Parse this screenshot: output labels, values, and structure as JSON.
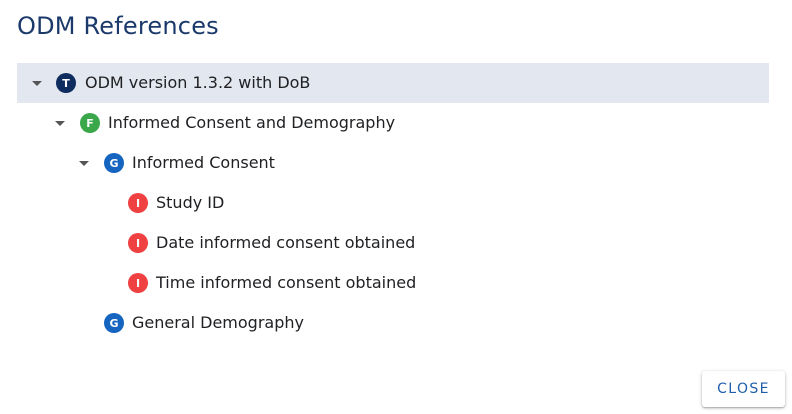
{
  "dialog": {
    "title": "ODM References",
    "close_label": "CLOSE"
  },
  "tree": [
    {
      "type_letter": "T",
      "type_color": "#0f2c5e",
      "label": "ODM version 1.3.2 with DoB",
      "expanded": true,
      "selected": true,
      "depth": 0
    },
    {
      "type_letter": "F",
      "type_color": "#3aa84a",
      "label": "Informed Consent and Demography",
      "expanded": true,
      "selected": false,
      "depth": 1
    },
    {
      "type_letter": "G",
      "type_color": "#1565c0",
      "label": "Informed Consent",
      "expanded": true,
      "selected": false,
      "depth": 2
    },
    {
      "type_letter": "I",
      "type_color": "#ef4141",
      "label": "Study ID",
      "expanded": false,
      "selected": false,
      "depth": 3
    },
    {
      "type_letter": "I",
      "type_color": "#ef4141",
      "label": "Date informed consent obtained",
      "expanded": false,
      "selected": false,
      "depth": 3
    },
    {
      "type_letter": "I",
      "type_color": "#ef4141",
      "label": "Time informed consent obtained",
      "expanded": false,
      "selected": false,
      "depth": 3
    },
    {
      "type_letter": "G",
      "type_color": "#1565c0",
      "label": "General Demography",
      "expanded": false,
      "selected": false,
      "depth": 2
    }
  ]
}
